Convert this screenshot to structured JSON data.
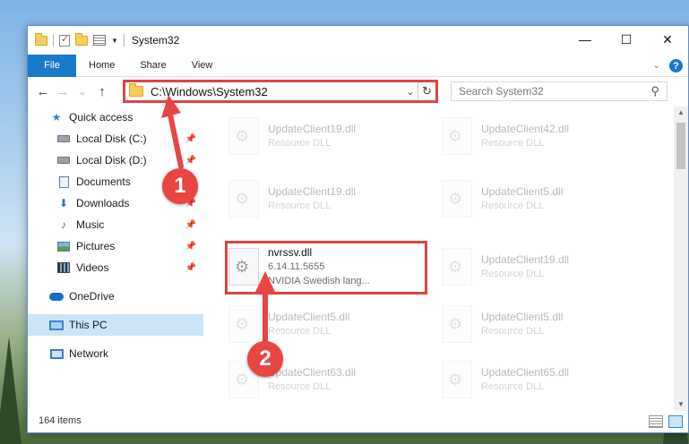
{
  "window": {
    "title": "System32",
    "controls": {
      "minimize": "—",
      "maximize": "☐",
      "close": "✕"
    }
  },
  "ribbon": {
    "file_label": "File",
    "tabs": [
      "Home",
      "Share",
      "View"
    ],
    "help": "?"
  },
  "nav": {
    "back": "←",
    "forward": "→",
    "recent": "⌄",
    "up": "↑",
    "address": "C:\\Windows\\System32",
    "refresh": "↻",
    "search_placeholder": "Search System32"
  },
  "sidebar": {
    "items": [
      {
        "label": "Quick access",
        "icon": "star-icon"
      },
      {
        "label": "Local Disk (C:)",
        "icon": "drive-icon",
        "pinned": true
      },
      {
        "label": "Local Disk (D:)",
        "icon": "drive-icon",
        "pinned": true
      },
      {
        "label": "Documents",
        "icon": "documents-icon",
        "pinned": true
      },
      {
        "label": "Downloads",
        "icon": "downloads-icon",
        "pinned": true
      },
      {
        "label": "Music",
        "icon": "music-icon",
        "pinned": true
      },
      {
        "label": "Pictures",
        "icon": "pictures-icon",
        "pinned": true
      },
      {
        "label": "Videos",
        "icon": "videos-icon",
        "pinned": true
      },
      {
        "label": "OneDrive",
        "icon": "onedrive-icon"
      },
      {
        "label": "This PC",
        "icon": "this-pc-icon",
        "selected": true
      },
      {
        "label": "Network",
        "icon": "network-icon"
      }
    ]
  },
  "files": [
    {
      "name": "UpdateClient19.dll",
      "type": "Resource DLL",
      "faded": true
    },
    {
      "name": "UpdateClient42.dll",
      "type": "Resource DLL",
      "faded": true
    },
    {
      "name": "UpdateClient19.dll",
      "type": "Resource DLL",
      "faded": true
    },
    {
      "name": "UpdateClient5.dll",
      "type": "Resource DLL",
      "faded": true
    },
    {
      "name": "nvrssv.dll",
      "version": "6.14.11.5655",
      "description": "NVIDIA Swedish lang...",
      "faded": false,
      "highlighted": true
    },
    {
      "name": "UpdateClient19.dll",
      "type": "Resource DLL",
      "faded": true
    },
    {
      "name": "UpdateClient5.dll",
      "type": "Resource DLL",
      "faded": true
    },
    {
      "name": "UpdateClient5.dll",
      "type": "Resource DLL",
      "faded": true
    },
    {
      "name": "UpdateClient63.dll",
      "type": "Resource DLL",
      "faded": true
    },
    {
      "name": "UpdateClient65.dll",
      "type": "Resource DLL",
      "faded": true
    }
  ],
  "status": {
    "item_count": "164 items"
  },
  "annotations": {
    "step1": "1",
    "step2": "2",
    "color": "#e04343"
  }
}
